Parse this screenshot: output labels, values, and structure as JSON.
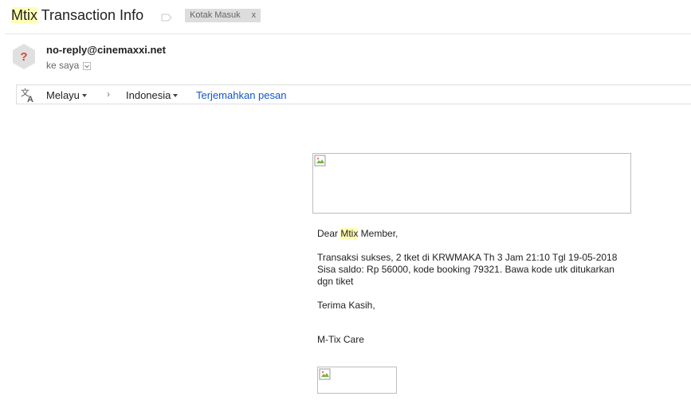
{
  "email": {
    "subject_highlight": "Mtix",
    "subject_rest": " Transaction Info",
    "label_chip": "Kotak Masuk",
    "label_remove": "x",
    "sender": "no-reply@cinemaxxi.net",
    "to_text": "ke saya"
  },
  "translate": {
    "from_lang": "Melayu",
    "arrow": "›",
    "to_lang": "Indonesia",
    "action": "Terjemahkan pesan"
  },
  "message": {
    "greeting_pre": "Dear ",
    "greeting_highlight": "Mtix",
    "greeting_post": " Member,",
    "paragraph": "Transaksi sukses, 2 tket di KRWMAKA Th 3 Jam 21:10 Tgl 19-05-2018 Sisa saldo: Rp 56000, kode booking 79321. Bawa kode utk ditukarkan dgn tiket",
    "closing": "Terima Kasih,",
    "signature": "M-Tix Care"
  },
  "colors": {
    "highlight": "#ffffb5",
    "link": "#1155cc",
    "avatar_bg": "#e0e0e0",
    "avatar_mark": "#db4437"
  }
}
